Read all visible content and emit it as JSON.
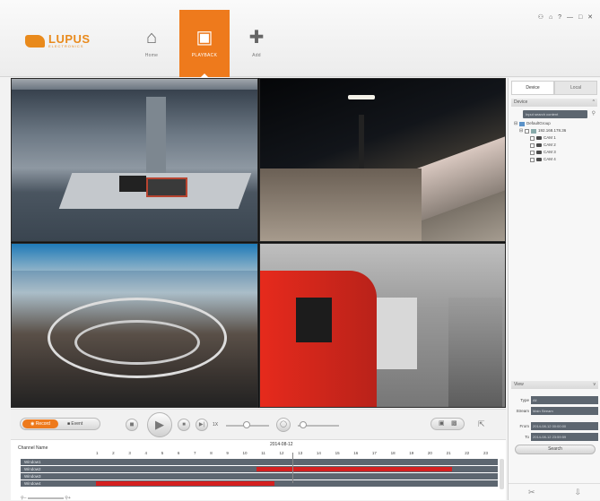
{
  "brand": {
    "name": "LUPUS",
    "subtitle": "ELECTRONICS"
  },
  "window_controls": "⚇ ⌂ ? — □ ✕",
  "nav": [
    {
      "label": "Home",
      "icon": "home-icon",
      "glyph": "⌂",
      "active": false
    },
    {
      "label": "PLAYBACK",
      "icon": "clapperboard-icon",
      "glyph": "▣",
      "active": true
    },
    {
      "label": "Add",
      "icon": "plus-icon",
      "glyph": "✚",
      "active": false
    }
  ],
  "panel": {
    "tabs": [
      "Device",
      "Local"
    ],
    "device_section": "Device",
    "search_placeholder": "Input search content",
    "tree": {
      "group": "DefaultGroup",
      "device": "192.168.178.36",
      "cameras": [
        "CAM 1",
        "CAM 2",
        "CAM 3",
        "CAM 4"
      ]
    },
    "view_section": "View",
    "fields": [
      {
        "label": "Type",
        "value": "All"
      },
      {
        "label": "Stream",
        "value": "Main Stream"
      },
      {
        "label": "From",
        "value": "2014-08-12 00:00:00"
      },
      {
        "label": "To",
        "value": "2014-08-12 23:59:59"
      }
    ],
    "search_button": "Search"
  },
  "controls": {
    "record_label": "Record",
    "event_label": "Event",
    "speed_label": "1X"
  },
  "timeline": {
    "label": "Channel Name",
    "date": "2014-08-12",
    "hours": [
      "1",
      "2",
      "3",
      "4",
      "5",
      "6",
      "7",
      "8",
      "9",
      "10",
      "11",
      "12",
      "13",
      "14",
      "15",
      "16",
      "17",
      "18",
      "19",
      "20",
      "21",
      "22",
      "23"
    ],
    "channels": [
      "Window1",
      "Window2",
      "Window3",
      "Window4"
    ],
    "recordings": [
      {
        "channel": 1,
        "start_hour": 10.0,
        "end_hour": 21.0
      },
      {
        "channel": 3,
        "start_hour": 1.0,
        "end_hour": 11.0
      }
    ],
    "cursor_hour": 12.0
  }
}
